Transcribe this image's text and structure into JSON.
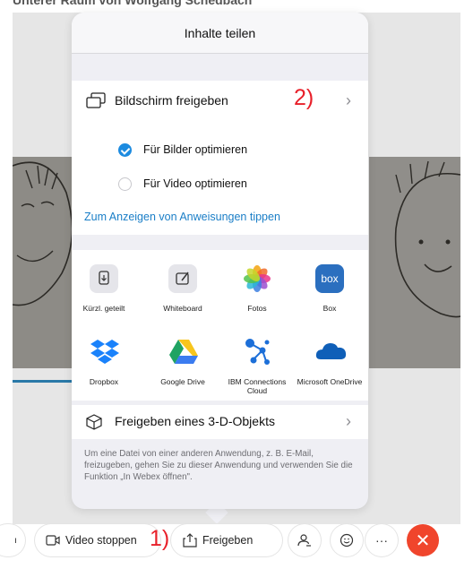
{
  "background": {
    "top_caption": "Unterer Raum von Wolfgang Schedbach"
  },
  "popover": {
    "title": "Inhalte teilen",
    "share_screen": {
      "label": "Bildschirm freigeben",
      "icon": "screen-share-icon",
      "annotation": "2)"
    },
    "options": [
      {
        "label": "Für Bilder optimieren",
        "selected": true
      },
      {
        "label": "Für Video optimieren",
        "selected": false
      }
    ],
    "instructions_link": "Zum Anzeigen von Anweisungen tippen",
    "apps": [
      {
        "label": "Kürzl. geteilt",
        "icon": "recent-shared-icon"
      },
      {
        "label": "Whiteboard",
        "icon": "whiteboard-icon"
      },
      {
        "label": "Fotos",
        "icon": "photos-icon"
      },
      {
        "label": "Box",
        "icon": "box-icon",
        "tile_text": "box"
      },
      {
        "label": "Dropbox",
        "icon": "dropbox-icon"
      },
      {
        "label": "Google Drive",
        "icon": "google-drive-icon"
      },
      {
        "label": "IBM Connections Cloud",
        "icon": "ibm-connections-icon"
      },
      {
        "label": "Microsoft OneDrive",
        "icon": "onedrive-icon"
      }
    ],
    "share_3d": {
      "label": "Freigeben eines 3-D-Objekts",
      "icon": "cube-icon"
    },
    "footer": "Um eine Datei von einer anderen Anwendung, z. B. E-Mail, freizugeben, gehen Sie zu dieser Anwendung und verwenden Sie die Funktion „In Webex öffnen\"."
  },
  "toolbar": {
    "video_stop": "Video stoppen",
    "share": "Freigeben",
    "annotation": "1)",
    "more": "···",
    "colors": {
      "end": "#f0452c",
      "accent": "#1c8be0"
    }
  }
}
